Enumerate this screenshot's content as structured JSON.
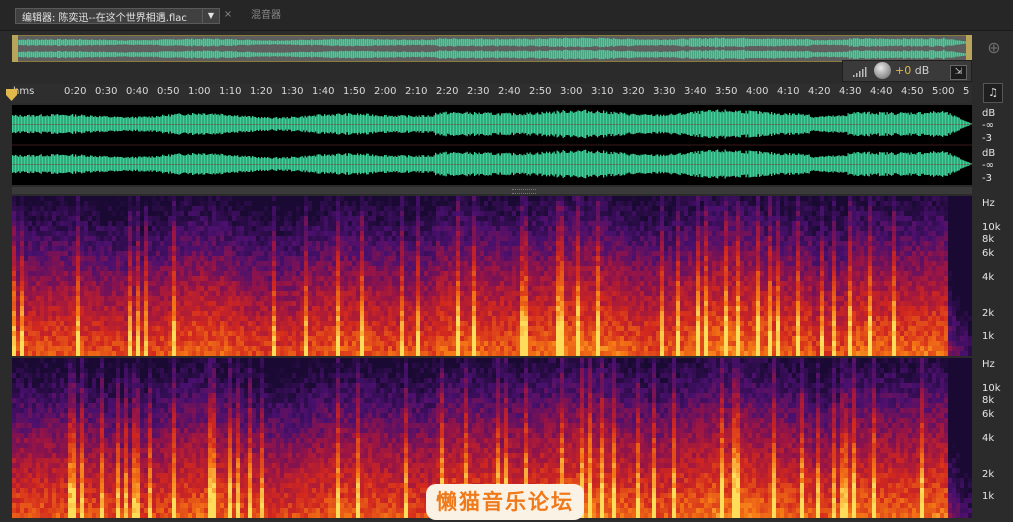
{
  "tabs": {
    "editor_label": "编辑器: 陈奕迅--在这个世界相遇.flac",
    "close_glyph": "×",
    "menu_glyph": "▼",
    "mixer_label": "混音器"
  },
  "level": {
    "value": "+0",
    "unit": "dB",
    "pin_glyph": "⇲"
  },
  "ruler": {
    "unit_label": "hms",
    "ticks": [
      "0:20",
      "0:30",
      "0:40",
      "0:50",
      "1:00",
      "1:10",
      "1:20",
      "1:30",
      "1:40",
      "1:50",
      "2:00",
      "2:10",
      "2:20",
      "2:30",
      "2:40",
      "2:50",
      "3:00",
      "3:10",
      "3:20",
      "3:30",
      "3:40",
      "3:50",
      "4:00",
      "4:10",
      "4:20",
      "4:30",
      "4:40",
      "4:50",
      "5:00",
      "5"
    ]
  },
  "waveform": {
    "channels": [
      {
        "labels": [
          "dB",
          "-∞",
          "-3"
        ]
      },
      {
        "labels": [
          "dB",
          "-∞",
          "-3"
        ]
      }
    ]
  },
  "spectrogram": {
    "channels": [
      {
        "labels": [
          "Hz",
          "10k",
          "8k",
          "6k",
          "4k",
          "2k",
          "1k"
        ]
      },
      {
        "labels": [
          "Hz",
          "10k",
          "8k",
          "6k",
          "4k",
          "2k",
          "1k"
        ]
      }
    ]
  },
  "icons": {
    "zoom": "zoom-icon",
    "headphone": "headphone-icon",
    "playhead": "playhead-icon",
    "knob": "volume-knob-icon"
  },
  "colors": {
    "waveform": "#3fd39a",
    "accent": "#e0b84c"
  },
  "watermark": "懒猫音乐论坛"
}
